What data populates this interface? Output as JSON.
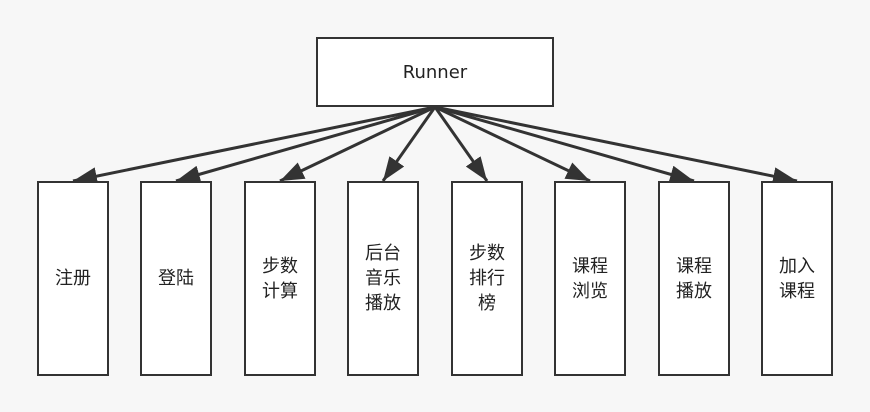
{
  "root": {
    "label": "Runner"
  },
  "children": [
    {
      "label": "注册"
    },
    {
      "label": "登陆"
    },
    {
      "label": "步数\n计算"
    },
    {
      "label": "后台\n音乐\n播放"
    },
    {
      "label": "步数\n排行\n榜"
    },
    {
      "label": "课程\n浏览"
    },
    {
      "label": "课程\n播放"
    },
    {
      "label": "加入\n课程"
    }
  ],
  "colors": {
    "stroke": "#333333",
    "node_fill": "#ffffff",
    "background": "#f7f7f7",
    "text": "#222222"
  }
}
